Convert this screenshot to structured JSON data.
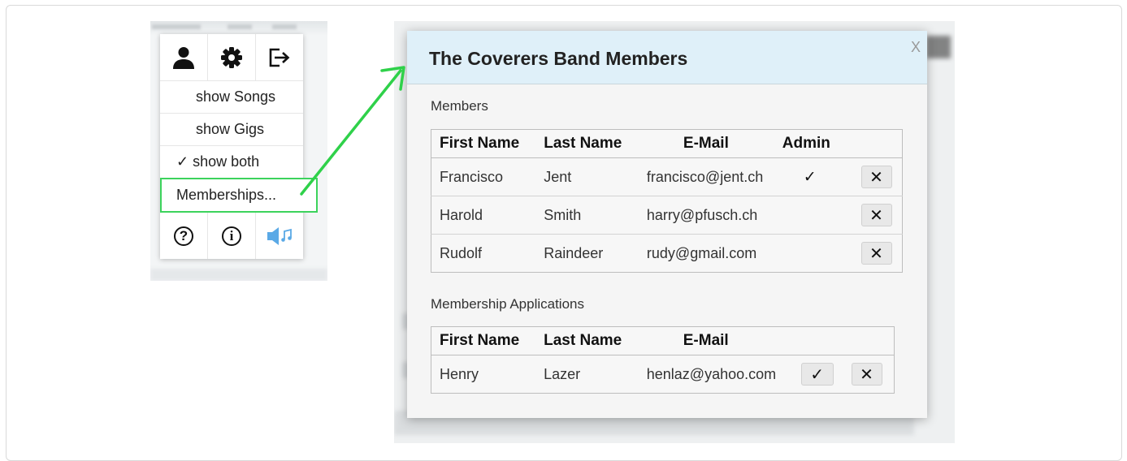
{
  "menu": {
    "icons": [
      "user-icon",
      "gear-icon",
      "logout-icon"
    ],
    "items": [
      {
        "label": "show Songs",
        "checked": false
      },
      {
        "label": "show Gigs",
        "checked": false
      },
      {
        "label": "show both",
        "checked": true,
        "check_mark": "✓"
      },
      {
        "label": "Memberships...",
        "highlighted": true
      }
    ],
    "bottom_icons": [
      "help-icon",
      "info-icon",
      "sound-icon"
    ],
    "help_glyph": "?",
    "info_glyph": "i"
  },
  "dialog": {
    "title": "The Coverers Band Members",
    "close_label": "X",
    "members_label": "Members",
    "members_headers": [
      "First Name",
      "Last Name",
      "E-Mail",
      "Admin"
    ],
    "members": [
      {
        "first": "Francisco",
        "last": "Jent",
        "email": "francisco@jent.ch",
        "admin": "✓",
        "remove": "✕"
      },
      {
        "first": "Harold",
        "last": "Smith",
        "email": "harry@pfusch.ch",
        "admin": "",
        "remove": "✕"
      },
      {
        "first": "Rudolf",
        "last": "Raindeer",
        "email": "rudy@gmail.com",
        "admin": "",
        "remove": "✕"
      }
    ],
    "applications_label": "Membership Applications",
    "applications_headers": [
      "First Name",
      "Last Name",
      "E-Mail"
    ],
    "applications": [
      {
        "first": "Henry",
        "last": "Lazer",
        "email": "henlaz@yahoo.com",
        "accept": "✓",
        "reject": "✕"
      }
    ]
  },
  "colors": {
    "highlight_border": "#3cd35c",
    "arrow": "#2fd14a",
    "dialog_header": "#dff0f9",
    "sound_icon": "#5aa9e6"
  }
}
